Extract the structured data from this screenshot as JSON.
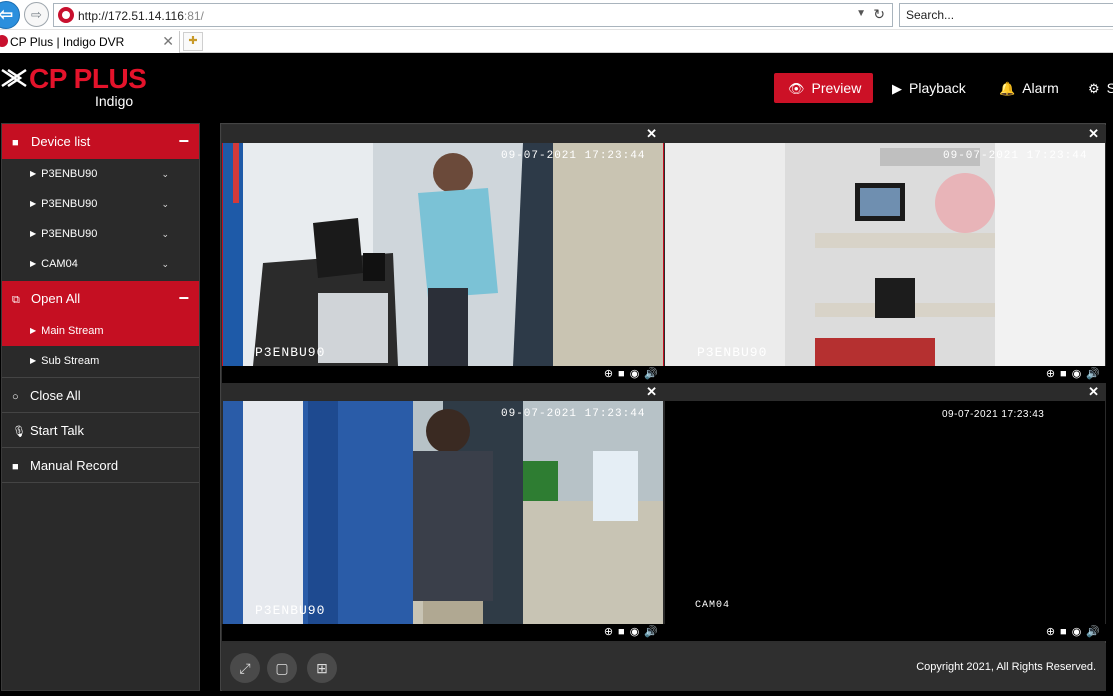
{
  "browser": {
    "url_host": "http://172.51.14.116",
    "url_port": ":81/",
    "search_placeholder": "Search...",
    "tab_title": "CP Plus | Indigo DVR"
  },
  "header": {
    "logo_text": "CP PLUS",
    "logo_sub": "Indigo",
    "nav": [
      {
        "label": "Preview",
        "icon": "eye-icon",
        "active": true
      },
      {
        "label": "Playback",
        "icon": "play-circle-icon",
        "active": false
      },
      {
        "label": "Alarm",
        "icon": "bell-icon",
        "active": false
      },
      {
        "label": "S",
        "icon": "gear-icon",
        "active": false
      }
    ]
  },
  "sidebar": {
    "device_list_label": "Device list",
    "devices": [
      {
        "label": "P3ENBU90"
      },
      {
        "label": "P3ENBU90"
      },
      {
        "label": "P3ENBU90"
      },
      {
        "label": "CAM04"
      }
    ],
    "open_all_label": "Open All",
    "streams": [
      {
        "label": "Main Stream",
        "selected": true
      },
      {
        "label": "Sub Stream",
        "selected": false
      }
    ],
    "actions": [
      {
        "label": "Close All",
        "icon": "circle-icon"
      },
      {
        "label": "Start Talk",
        "icon": "microphone-icon"
      },
      {
        "label": "Manual Record",
        "icon": "video-camera-icon"
      }
    ]
  },
  "tiles": [
    {
      "timestamp": "09-07-2021 17:23:44",
      "camera_name": "P3ENBU90",
      "selected": true
    },
    {
      "timestamp": "09-07-2021 17:23:44",
      "camera_name": "P3ENBU90",
      "selected": false
    },
    {
      "timestamp": "09-07-2021 17:23:44",
      "camera_name": "P3ENBU90",
      "selected": false
    },
    {
      "timestamp": "09-07-2021 17:23:43",
      "camera_name": "CAM04",
      "selected": false
    }
  ],
  "footer": {
    "copyright": "Copyright 2021, All Rights Reserved."
  },
  "colors": {
    "brand_red": "#c50f22",
    "background": "#000000",
    "panel": "#2a2a2a"
  }
}
